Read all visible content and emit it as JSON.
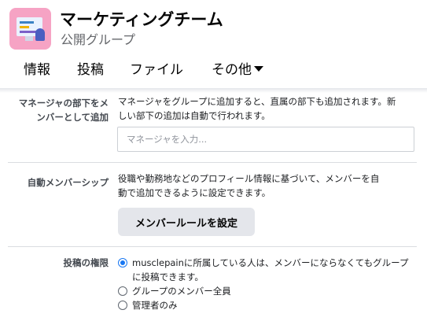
{
  "group": {
    "name": "マーケティングチーム",
    "privacy": "公開グループ",
    "icon": "group-cover-icon"
  },
  "tabs": [
    {
      "label": "情報"
    },
    {
      "label": "投稿"
    },
    {
      "label": "ファイル"
    },
    {
      "label": "その他"
    }
  ],
  "settings": {
    "manager": {
      "label_line1": "マネージャの部下をメ",
      "label_line2": "ンバーとして追加",
      "description_line1": "マネージャをグループに追加すると、直属の部下も追加されます。新",
      "description_line2": "しい部下の追加は自動で行われます。",
      "input_placeholder": "マネージャを入力...",
      "input_value": ""
    },
    "auto_membership": {
      "label": "自動メンバーシップ",
      "description_line1": "役職や勤務地などのプロフィール情報に基づいて、メンバーを自",
      "description_line2": "動で追加できるように設定できます。",
      "button_label": "メンバールールを設定"
    },
    "posting_permissions": {
      "label": "投稿の権限",
      "options": [
        {
          "line1": "musclepainに所属している人は、メンバーにならなくてもグループ",
          "line2": "に投稿できます。",
          "selected": true
        },
        {
          "line1": "グループのメンバー全員",
          "selected": false
        },
        {
          "line1": "管理者のみ",
          "selected": false
        }
      ]
    }
  },
  "colors": {
    "accent": "#1877f2",
    "button_bg": "#e4e6eb",
    "divider": "#dadde1"
  }
}
